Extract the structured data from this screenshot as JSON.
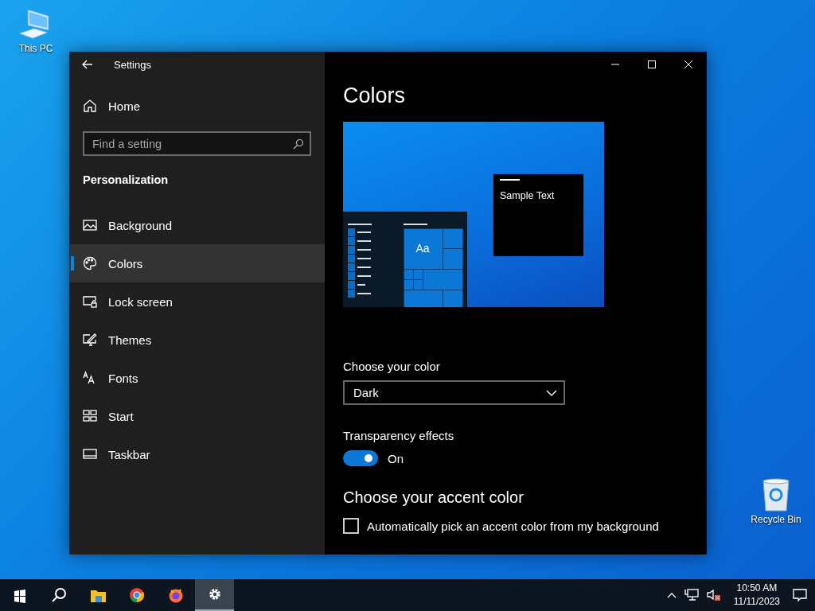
{
  "desktop_icons": [
    {
      "kind": "computer",
      "label": "This PC"
    },
    {
      "kind": "recycle",
      "label": "Recycle Bin"
    }
  ],
  "window": {
    "title": "Settings"
  },
  "sidebar": {
    "home": "Home",
    "search": {
      "placeholder": "Find a setting"
    },
    "section": "Personalization",
    "items": [
      {
        "kind": "picture",
        "label": "Background",
        "selected": false
      },
      {
        "kind": "palette",
        "label": "Colors",
        "selected": true
      },
      {
        "kind": "lock",
        "label": "Lock screen",
        "selected": false
      },
      {
        "kind": "brush",
        "label": "Themes",
        "selected": false
      },
      {
        "kind": "fonts",
        "label": "Fonts",
        "selected": false
      },
      {
        "kind": "tiles",
        "label": "Start",
        "selected": false
      },
      {
        "kind": "taskbar",
        "label": "Taskbar",
        "selected": false
      }
    ]
  },
  "content": {
    "title": "Colors",
    "preview": {
      "tile_text": "Aa",
      "sample_text": "Sample Text"
    },
    "choose_color": {
      "label": "Choose your color",
      "value": "Dark"
    },
    "transparency": {
      "label": "Transparency effects",
      "on": true,
      "state_text": "On"
    },
    "accent_heading": "Choose your accent color",
    "auto_pick": {
      "label": "Automatically pick an accent color from my background",
      "checked": false
    }
  },
  "taskbar": {
    "apps": [
      {
        "kind": "start",
        "selected": false
      },
      {
        "kind": "search",
        "selected": false
      },
      {
        "kind": "folder",
        "selected": false
      },
      {
        "kind": "chrome",
        "selected": false
      },
      {
        "kind": "firefox",
        "selected": false
      },
      {
        "kind": "settings",
        "selected": true
      }
    ],
    "clock": {
      "time": "10:50 AM",
      "date": "11/11/2023"
    }
  }
}
